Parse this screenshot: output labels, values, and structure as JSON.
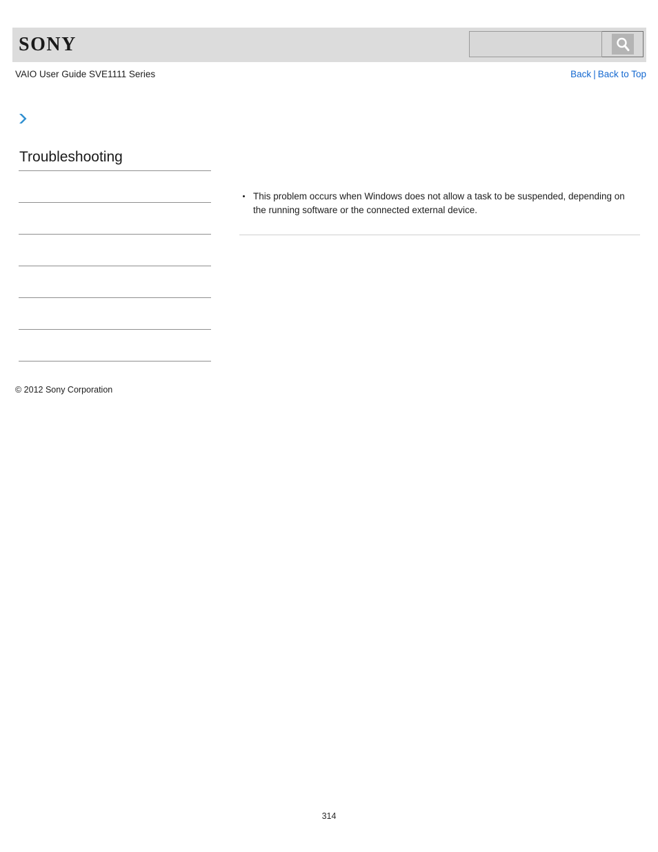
{
  "header": {
    "logo_text": "SONY",
    "logo_icon": "sony-wordmark",
    "search": {
      "value": "",
      "placeholder": "",
      "button_icon": "search-magnifier-icon",
      "button_label": "Search"
    }
  },
  "title_row": {
    "guide_title": "VAIO User Guide SVE1111 Series",
    "links": {
      "back": "Back",
      "separator": "|",
      "back_to_top": "Back to Top"
    }
  },
  "marker": {
    "icon": "blue-chevron-right-icon"
  },
  "sidebar": {
    "heading": "Troubleshooting",
    "items": [
      {
        "label": ""
      },
      {
        "label": ""
      },
      {
        "label": ""
      },
      {
        "label": ""
      },
      {
        "label": ""
      },
      {
        "label": ""
      }
    ]
  },
  "main": {
    "bullets": [
      "This problem occurs when Windows does not allow a task to be suspended, depending on the running software or the connected external device."
    ]
  },
  "footer": {
    "copyright": "© 2012 Sony Corporation",
    "page_number": "314"
  },
  "colors": {
    "header_bg": "#dcdcdc",
    "link_blue": "#1368d0",
    "chevron_blue": "#2f8fd0",
    "divider_gray": "#8e8e8e",
    "content_divider_gray": "#cfcfcf",
    "text": "#1c1c1c"
  }
}
